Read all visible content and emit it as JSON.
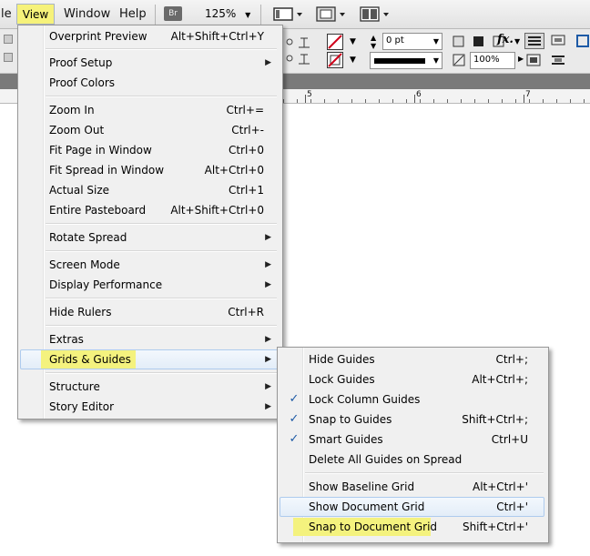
{
  "menubar": {
    "items": [
      {
        "label": "le"
      },
      {
        "label": "View"
      },
      {
        "label": "Window"
      },
      {
        "label": "Help"
      }
    ],
    "bridge_badge": "Br",
    "zoom": "125%",
    "highlight_color": "#f6f27a"
  },
  "control_panel": {
    "stroke_weight": "0 pt",
    "opacity": "100%",
    "fx_label": "fx."
  },
  "ruler": {
    "numbers": [
      "5",
      "6",
      "7"
    ]
  },
  "view_menu": {
    "items": [
      {
        "label": "Overprint Preview",
        "shortcut": "Alt+Shift+Ctrl+Y"
      },
      {
        "label": "Proof Setup",
        "submenu": true
      },
      {
        "label": "Proof Colors"
      },
      {
        "label": "Zoom In",
        "shortcut": "Ctrl+="
      },
      {
        "label": "Zoom Out",
        "shortcut": "Ctrl+-"
      },
      {
        "label": "Fit Page in Window",
        "shortcut": "Ctrl+0"
      },
      {
        "label": "Fit Spread in Window",
        "shortcut": "Alt+Ctrl+0"
      },
      {
        "label": "Actual Size",
        "shortcut": "Ctrl+1"
      },
      {
        "label": "Entire Pasteboard",
        "shortcut": "Alt+Shift+Ctrl+0"
      },
      {
        "label": "Rotate Spread",
        "submenu": true
      },
      {
        "label": "Screen Mode",
        "submenu": true
      },
      {
        "label": "Display Performance",
        "submenu": true
      },
      {
        "label": "Hide Rulers",
        "shortcut": "Ctrl+R"
      },
      {
        "label": "Extras",
        "submenu": true
      },
      {
        "label": "Grids & Guides",
        "submenu": true,
        "highlighted": true
      },
      {
        "label": "Structure",
        "submenu": true
      },
      {
        "label": "Story Editor",
        "submenu": true
      }
    ]
  },
  "grids_submenu": {
    "items": [
      {
        "label": "Hide Guides",
        "shortcut": "Ctrl+;"
      },
      {
        "label": "Lock Guides",
        "shortcut": "Alt+Ctrl+;"
      },
      {
        "label": "Lock Column Guides",
        "checked": true
      },
      {
        "label": "Snap to Guides",
        "shortcut": "Shift+Ctrl+;",
        "checked": true
      },
      {
        "label": "Smart Guides",
        "shortcut": "Ctrl+U",
        "checked": true
      },
      {
        "label": "Delete All Guides on Spread"
      },
      {
        "label": "Show Baseline Grid",
        "shortcut": "Alt+Ctrl+'"
      },
      {
        "label": "Show Document Grid",
        "shortcut": "Ctrl+'",
        "hovered": true
      },
      {
        "label": "Snap to Document Grid",
        "shortcut": "Shift+Ctrl+'",
        "highlighted": true
      }
    ]
  }
}
